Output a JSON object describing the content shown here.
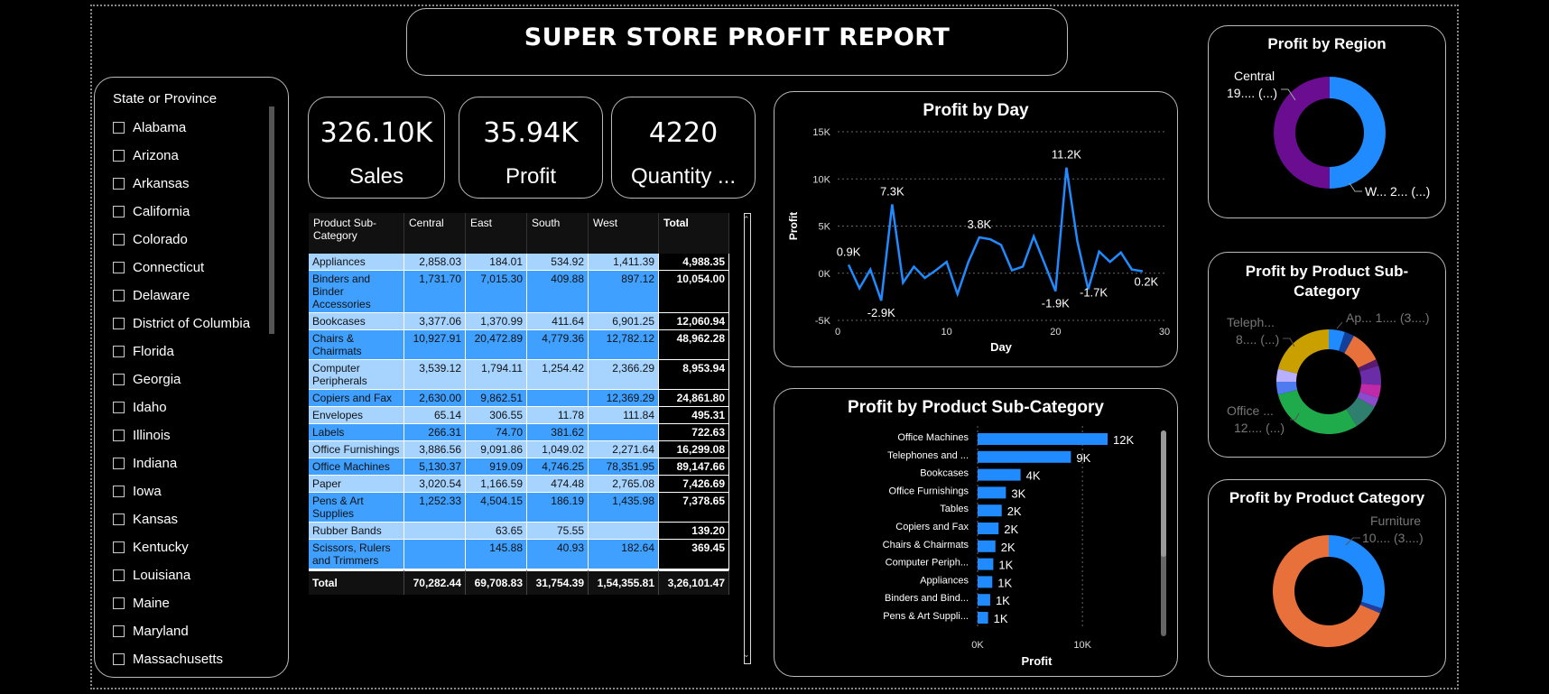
{
  "report": {
    "title": "SUPER STORE PROFIT REPORT"
  },
  "slicer": {
    "title": "State or Province",
    "items": [
      "Alabama",
      "Arizona",
      "Arkansas",
      "California",
      "Colorado",
      "Connecticut",
      "Delaware",
      "District of Columbia",
      "Florida",
      "Georgia",
      "Idaho",
      "Illinois",
      "Indiana",
      "Iowa",
      "Kansas",
      "Kentucky",
      "Louisiana",
      "Maine",
      "Maryland",
      "Massachusetts"
    ]
  },
  "kpis": [
    {
      "value": "326.10K",
      "label": "Sales"
    },
    {
      "value": "35.94K",
      "label": "Profit"
    },
    {
      "value": "4220",
      "label": "Quantity ..."
    }
  ],
  "matrix": {
    "headers": [
      "Product Sub-Category",
      "Central",
      "East",
      "South",
      "West",
      "Total"
    ],
    "rows": [
      {
        "name": "Appliances",
        "central": "2,858.03",
        "east": "184.01",
        "south": "534.92",
        "west": "1,411.39",
        "total": "4,988.35"
      },
      {
        "name": "Binders and Binder Accessories",
        "central": "1,731.70",
        "east": "7,015.30",
        "south": "409.88",
        "west": "897.12",
        "total": "10,054.00"
      },
      {
        "name": "Bookcases",
        "central": "3,377.06",
        "east": "1,370.99",
        "south": "411.64",
        "west": "6,901.25",
        "total": "12,060.94"
      },
      {
        "name": "Chairs & Chairmats",
        "central": "10,927.91",
        "east": "20,472.89",
        "south": "4,779.36",
        "west": "12,782.12",
        "total": "48,962.28"
      },
      {
        "name": "Computer Peripherals",
        "central": "3,539.12",
        "east": "1,794.11",
        "south": "1,254.42",
        "west": "2,366.29",
        "total": "8,953.94"
      },
      {
        "name": "Copiers and Fax",
        "central": "2,630.00",
        "east": "9,862.51",
        "south": "",
        "west": "12,369.29",
        "total": "24,861.80"
      },
      {
        "name": "Envelopes",
        "central": "65.14",
        "east": "306.55",
        "south": "11.78",
        "west": "111.84",
        "total": "495.31"
      },
      {
        "name": "Labels",
        "central": "266.31",
        "east": "74.70",
        "south": "381.62",
        "west": "",
        "total": "722.63"
      },
      {
        "name": "Office Furnishings",
        "central": "3,886.56",
        "east": "9,091.86",
        "south": "1,049.02",
        "west": "2,271.64",
        "total": "16,299.08"
      },
      {
        "name": "Office Machines",
        "central": "5,130.37",
        "east": "919.09",
        "south": "4,746.25",
        "west": "78,351.95",
        "total": "89,147.66"
      },
      {
        "name": "Paper",
        "central": "3,020.54",
        "east": "1,166.59",
        "south": "474.48",
        "west": "2,765.08",
        "total": "7,426.69"
      },
      {
        "name": "Pens & Art Supplies",
        "central": "1,252.33",
        "east": "4,504.15",
        "south": "186.19",
        "west": "1,435.98",
        "total": "7,378.65"
      },
      {
        "name": "Rubber Bands",
        "central": "",
        "east": "63.65",
        "south": "75.55",
        "west": "",
        "total": "139.20"
      },
      {
        "name": "Scissors, Rulers and Trimmers",
        "central": "",
        "east": "145.88",
        "south": "40.93",
        "west": "182.64",
        "total": "369.45"
      }
    ],
    "footer": {
      "name": "Total",
      "central": "70,282.44",
      "east": "69,708.83",
      "south": "31,754.39",
      "west": "1,54,355.81",
      "total": "3,26,101.47"
    }
  },
  "panels": {
    "day": "Profit by Day",
    "subcat": "Profit by Product Sub-Category",
    "region": "Profit by Region",
    "psub": "Profit by Product Sub-Category",
    "pcat": "Profit by Product Category"
  },
  "chart_data": [
    {
      "type": "line",
      "title": "Profit by Day",
      "xlabel": "Day",
      "ylabel": "Profit",
      "xlim": [
        0,
        30
      ],
      "ylim": [
        -5000,
        15000
      ],
      "xticks": [
        "0",
        "10",
        "20",
        "30"
      ],
      "yticks": [
        "-5K",
        "0K",
        "5K",
        "10K",
        "15K"
      ],
      "grid": true,
      "color": "#1f8bff",
      "x": [
        1,
        2,
        3,
        4,
        5,
        6,
        7,
        8,
        9,
        10,
        11,
        12,
        13,
        14,
        15,
        16,
        17,
        18,
        19,
        20,
        21,
        22,
        23,
        24,
        25,
        26,
        27,
        28
      ],
      "y": [
        900,
        -1600,
        400,
        -2900,
        7300,
        -1000,
        700,
        -500,
        300,
        1200,
        -2200,
        1200,
        3800,
        3600,
        3000,
        300,
        700,
        3900,
        1000,
        -1900,
        11200,
        3400,
        -1700,
        2300,
        1200,
        2200,
        400,
        200
      ],
      "data_labels": [
        {
          "x": 1,
          "text": "0.9K"
        },
        {
          "x": 4,
          "text": "-2.9K"
        },
        {
          "x": 5,
          "text": "7.3K"
        },
        {
          "x": 13,
          "text": "3.8K"
        },
        {
          "x": 20,
          "text": "-1.9K"
        },
        {
          "x": 21,
          "text": "11.2K"
        },
        {
          "x": 23,
          "text": "-1.7K"
        },
        {
          "x": 28,
          "text": "0.2K"
        }
      ]
    },
    {
      "type": "bar",
      "title": "Profit by Product Sub-Category",
      "xlabel": "Profit",
      "xlim": [
        0,
        13000
      ],
      "xticks": [
        "0K",
        "10K"
      ],
      "color": "#1f8bff",
      "categories": [
        "Office Machines",
        "Telephones and ...",
        "Bookcases",
        "Office Furnishings",
        "Tables",
        "Copiers and Fax",
        "Chairs & Chairmats",
        "Computer Periph...",
        "Appliances",
        "Binders and Bind...",
        "Pens & Art Suppli..."
      ],
      "values": [
        12400,
        8900,
        4100,
        2700,
        2300,
        2000,
        1700,
        1500,
        1400,
        1200,
        1000
      ],
      "labels": [
        "12K",
        "9K",
        "4K",
        "3K",
        "2K",
        "2K",
        "2K",
        "1K",
        "1K",
        "1K",
        "1K"
      ]
    },
    {
      "type": "pie",
      "title": "Profit by Region",
      "slices": [
        {
          "name": "Central",
          "value": 0.5,
          "color": "#1f8bff"
        },
        {
          "name": "West",
          "value": 0.5,
          "color": "#6a0d91"
        }
      ],
      "labels": [
        "Central\n19.... (...)",
        "W... 2... (...)"
      ]
    },
    {
      "type": "pie",
      "title": "Profit by Product Sub-Category",
      "slices": [
        {
          "value": 0.05,
          "color": "#1f8bff"
        },
        {
          "value": 0.03,
          "color": "#123f99"
        },
        {
          "value": 0.1,
          "color": "#e8703a"
        },
        {
          "value": 0.02,
          "color": "#5a1a6e"
        },
        {
          "value": 0.06,
          "color": "#6b2ca8"
        },
        {
          "value": 0.04,
          "color": "#c02aa8"
        },
        {
          "value": 0.03,
          "color": "#8a4ccc"
        },
        {
          "value": 0.08,
          "color": "#2e7f6d"
        },
        {
          "value": 0.3,
          "color": "#1faa4b"
        },
        {
          "value": 0.04,
          "color": "#4e7cf0"
        },
        {
          "value": 0.04,
          "color": "#b8b0ff"
        },
        {
          "value": 0.21,
          "color": "#c9a000"
        }
      ],
      "labels": [
        "Teleph... 8.... (...)",
        "Ap... 1.... (3....)",
        "Office ... 12.... (...)"
      ]
    },
    {
      "type": "pie",
      "title": "Profit by Product Category",
      "slices": [
        {
          "value": 0.3,
          "color": "#1f8bff"
        },
        {
          "value": 0.015,
          "color": "#2040a0"
        },
        {
          "value": 0.685,
          "color": "#e8703a"
        }
      ],
      "labels": [
        "Furniture 10.... (3....)"
      ]
    }
  ]
}
